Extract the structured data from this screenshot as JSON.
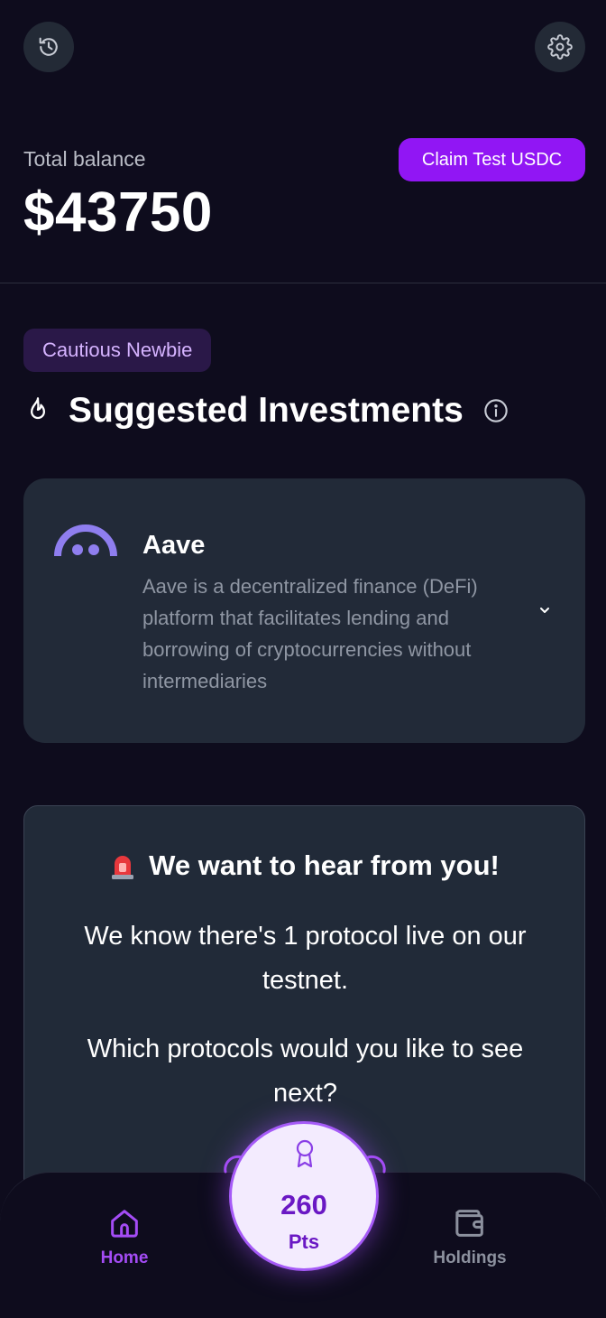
{
  "header": {
    "history_icon": "history-icon",
    "settings_icon": "gear-icon"
  },
  "balance": {
    "label": "Total balance",
    "value": "$43750",
    "claim_button": "Claim Test USDC"
  },
  "profile": {
    "badge": "Cautious Newbie"
  },
  "suggested": {
    "title": "Suggested Investments",
    "cards": [
      {
        "name": "Aave",
        "description": "Aave is a decentralized finance (DeFi) platform that facilitates lending and borrowing of cryptocurrencies without intermediaries",
        "logo_icon": "aave-logo"
      }
    ]
  },
  "feedback": {
    "emoji": "🚨",
    "title": "We want to hear from you!",
    "paragraph1": "We know there's 1 protocol live on our testnet.",
    "paragraph2": "Which protocols would you like to see next?"
  },
  "bottom_nav": {
    "home_label": "Home",
    "holdings_label": "Holdings",
    "points_value": "260",
    "points_label": "Pts"
  },
  "colors": {
    "background": "#0e0c1d",
    "card": "#222a38",
    "accent": "#9116f4",
    "badge_bg": "#2a1848",
    "badge_text": "#d5b3ff",
    "nav_active": "#a44cf5",
    "nav_inactive": "#8c919e",
    "aave_logo": "#8f7eef"
  }
}
